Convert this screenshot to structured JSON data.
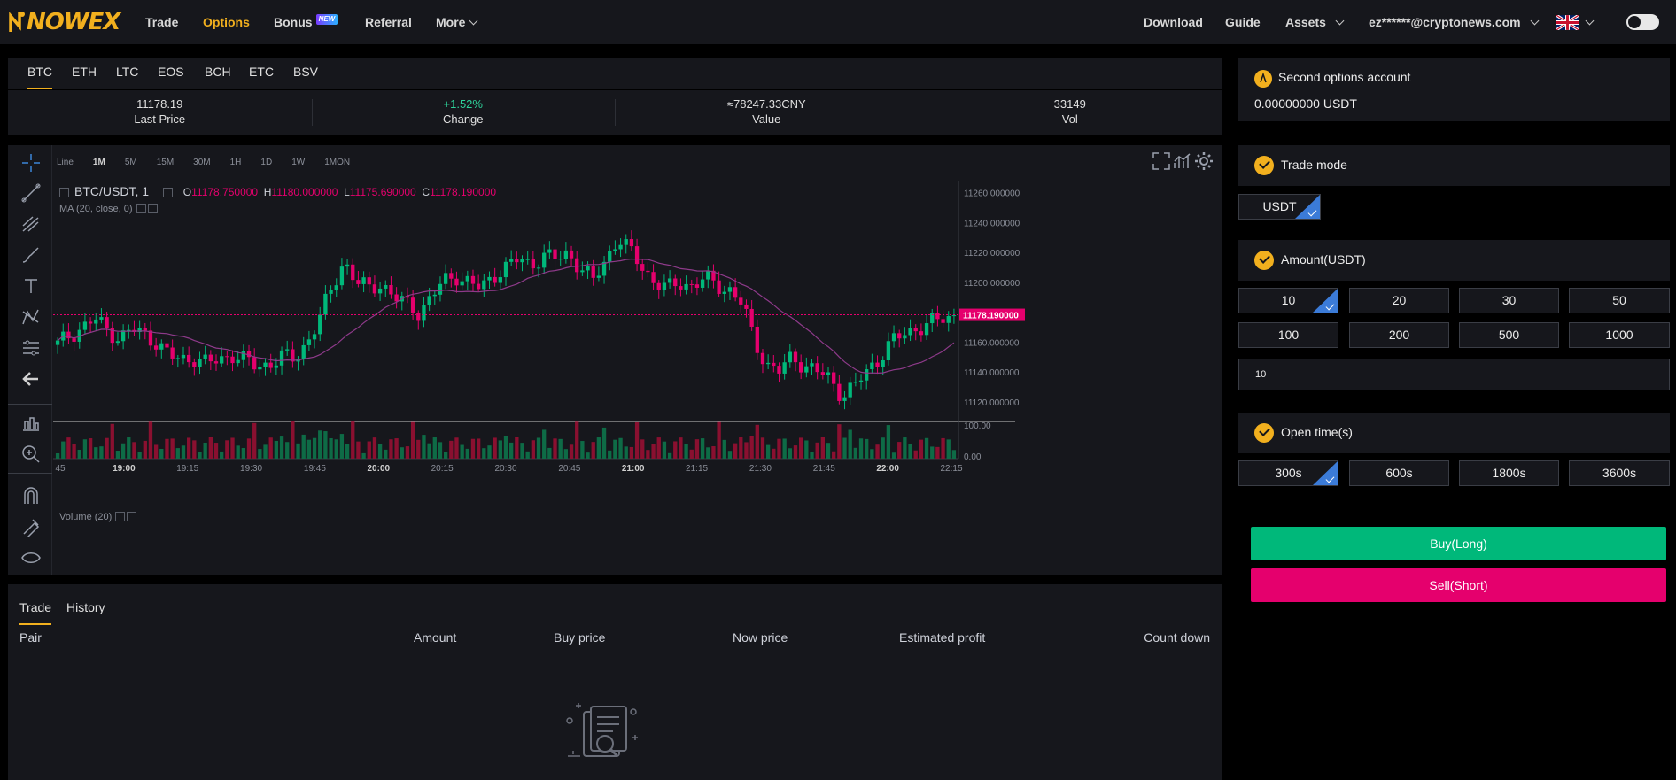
{
  "nav": {
    "logo": "NOWEX",
    "items": [
      {
        "label": "Trade",
        "name": "nav-trade"
      },
      {
        "label": "Options",
        "name": "nav-options"
      },
      {
        "label": "Bonus",
        "name": "nav-bonus"
      },
      {
        "label": "Referral",
        "name": "nav-referral"
      },
      {
        "label": "More",
        "name": "nav-more"
      }
    ],
    "bonus_badge": "NEW",
    "right": {
      "download": "Download",
      "guide": "Guide",
      "assets": "Assets",
      "account": "ez******@cryptonews.com"
    }
  },
  "coins": [
    "BTC",
    "ETH",
    "LTC",
    "EOS",
    "BCH",
    "ETC",
    "BSV"
  ],
  "stats": [
    {
      "value": "11178.19",
      "label": "Last Price"
    },
    {
      "value": "+1.52%",
      "label": "Change"
    },
    {
      "value": "≈78247.33CNY",
      "label": "Value"
    },
    {
      "value": "33149",
      "label": "Vol"
    }
  ],
  "chart": {
    "timeframes": [
      "Line",
      "1M",
      "5M",
      "15M",
      "30M",
      "1H",
      "1D",
      "1W",
      "1MON"
    ],
    "symbol": "BTC/USDT, 1",
    "o": "11178.750000",
    "h": "11180.000000",
    "l": "11175.690000",
    "c": "11178.190000",
    "ma_label": "MA (20, close, 0)",
    "volume_label": "Volume (20)"
  },
  "chart_data": {
    "type": "candlestick",
    "title": "BTC/USDT, 1",
    "x_ticks": [
      "45",
      "19:00",
      "19:15",
      "19:30",
      "19:45",
      "20:00",
      "20:15",
      "20:30",
      "20:45",
      "21:00",
      "21:15",
      "21:30",
      "21:45",
      "22:00",
      "22:15"
    ],
    "y_ticks": [
      "11260.000000",
      "11240.000000",
      "11220.000000",
      "11200.000000",
      "11180.000000",
      "11160.000000",
      "11140.000000",
      "11120.000000"
    ],
    "ylim": [
      11108,
      11268
    ],
    "last_price": "11178.190000",
    "last_price_value": 11178.19,
    "volume_ticks": [
      "100.00",
      "0.00"
    ],
    "close_path": [
      11158,
      11165,
      11170,
      11175,
      11168,
      11163,
      11168,
      11165,
      11160,
      11150,
      11148,
      11150,
      11145,
      11148,
      11152,
      11148,
      11143,
      11146,
      11150,
      11148,
      11160,
      11175,
      11195,
      11215,
      11200,
      11195,
      11200,
      11190,
      11185,
      11180,
      11190,
      11200,
      11205,
      11200,
      11195,
      11205,
      11210,
      11215,
      11212,
      11218,
      11215,
      11220,
      11210,
      11200,
      11215,
      11230,
      11220,
      11210,
      11200,
      11195,
      11200,
      11198,
      11202,
      11198,
      11195,
      11185,
      11160,
      11145,
      11140,
      11150,
      11145,
      11140,
      11135,
      11125,
      11130,
      11140,
      11150,
      11160,
      11165,
      11170,
      11172,
      11175,
      11178
    ]
  },
  "bottom": {
    "tabs": [
      "Trade",
      "History"
    ],
    "columns": [
      "Pair",
      "Amount",
      "Buy price",
      "Now price",
      "Estimated profit",
      "Count down"
    ]
  },
  "right": {
    "account_title": "Second options account",
    "balance": "0.00000000 USDT",
    "trade_mode_title": "Trade mode",
    "trade_mode_value": "USDT",
    "amount_title": "Amount(USDT)",
    "amounts": [
      "10",
      "20",
      "30",
      "50",
      "100",
      "200",
      "500",
      "1000"
    ],
    "amount_input": "10",
    "open_time_title": "Open time(s)",
    "open_times": [
      "300s",
      "600s",
      "1800s",
      "3600s"
    ],
    "buy_label": "Buy(Long)",
    "sell_label": "Sell(Short)"
  },
  "colors": {
    "accent": "#f2b01e",
    "up": "#00b87a",
    "down": "#e5006d",
    "panel": "#16171c"
  }
}
